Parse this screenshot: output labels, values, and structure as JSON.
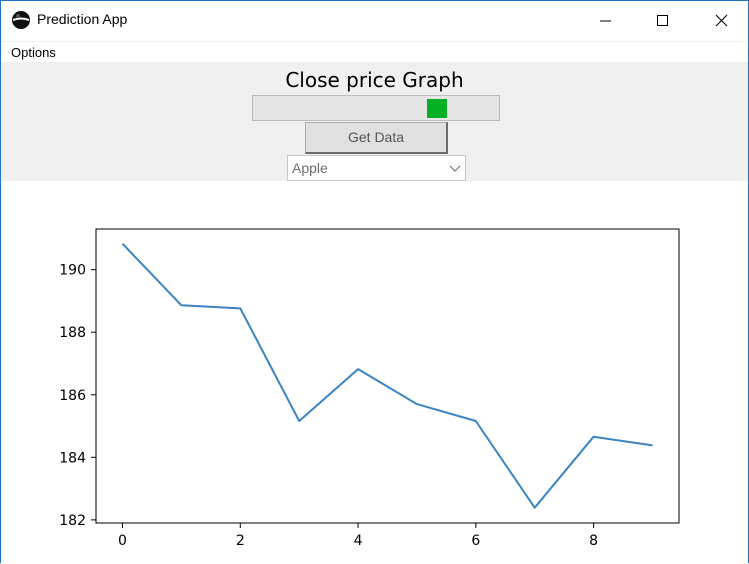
{
  "window": {
    "title": "Prediction App",
    "icons": {
      "app": "black-sphere-app-icon",
      "minimize": "minimize-icon",
      "maximize": "maximize-icon",
      "close": "close-icon"
    }
  },
  "menu": {
    "options_label": "Options"
  },
  "controls": {
    "title": "Close price Graph",
    "progress_fraction": 0.74,
    "get_data_label": "Get Data",
    "dropdown_value": "Apple",
    "progress_color": "#06b025"
  },
  "chart_data": {
    "type": "line",
    "title": "",
    "xlabel": "",
    "ylabel": "",
    "x": [
      0,
      1,
      2,
      3,
      4,
      5,
      6,
      7,
      8,
      9
    ],
    "series": [
      {
        "values": [
          190.83,
          188.86,
          188.76,
          185.16,
          186.82,
          185.7,
          185.16,
          182.39,
          184.66,
          184.38
        ],
        "color": "#3a84c4"
      }
    ],
    "xticks": [
      0,
      2,
      4,
      6,
      8
    ],
    "yticks": [
      182,
      184,
      186,
      188,
      190
    ],
    "xlim": [
      -0.45,
      9.45
    ],
    "ylim": [
      181.9,
      191.3
    ],
    "grid": false
  }
}
